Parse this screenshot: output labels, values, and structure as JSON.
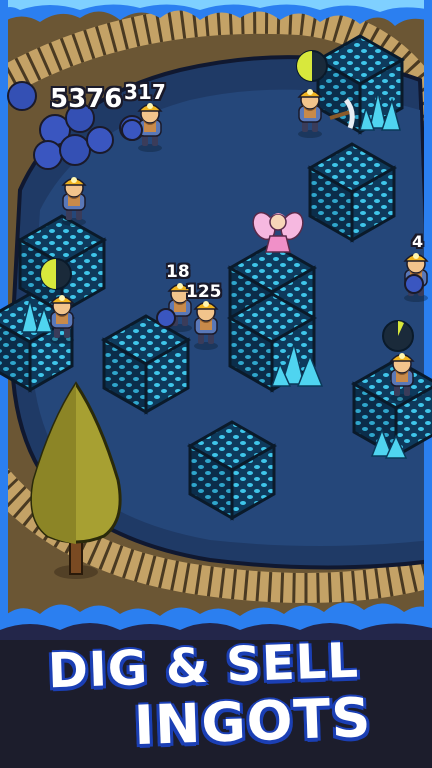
{
  "hud": {
    "collect_total": "5376",
    "collect_secondary": "317",
    "miner_count_a": "18",
    "miner_count_b": "125",
    "edge_count": "4"
  },
  "promo": {
    "line1": "DIG & SELL",
    "line2": "INGOTS"
  },
  "colors": {
    "pit": "#1f3a66",
    "ore_top": "#2a6f9e",
    "crystal": "#4fd4f0",
    "promo_outline": "#1b3fb4",
    "timer": "#d8e83c"
  },
  "icons": [
    "pickaxe-icon",
    "timer-icon",
    "crystal-icon",
    "tree-icon",
    "fairy-icon",
    "miner-icon",
    "ore-block-icon"
  ]
}
